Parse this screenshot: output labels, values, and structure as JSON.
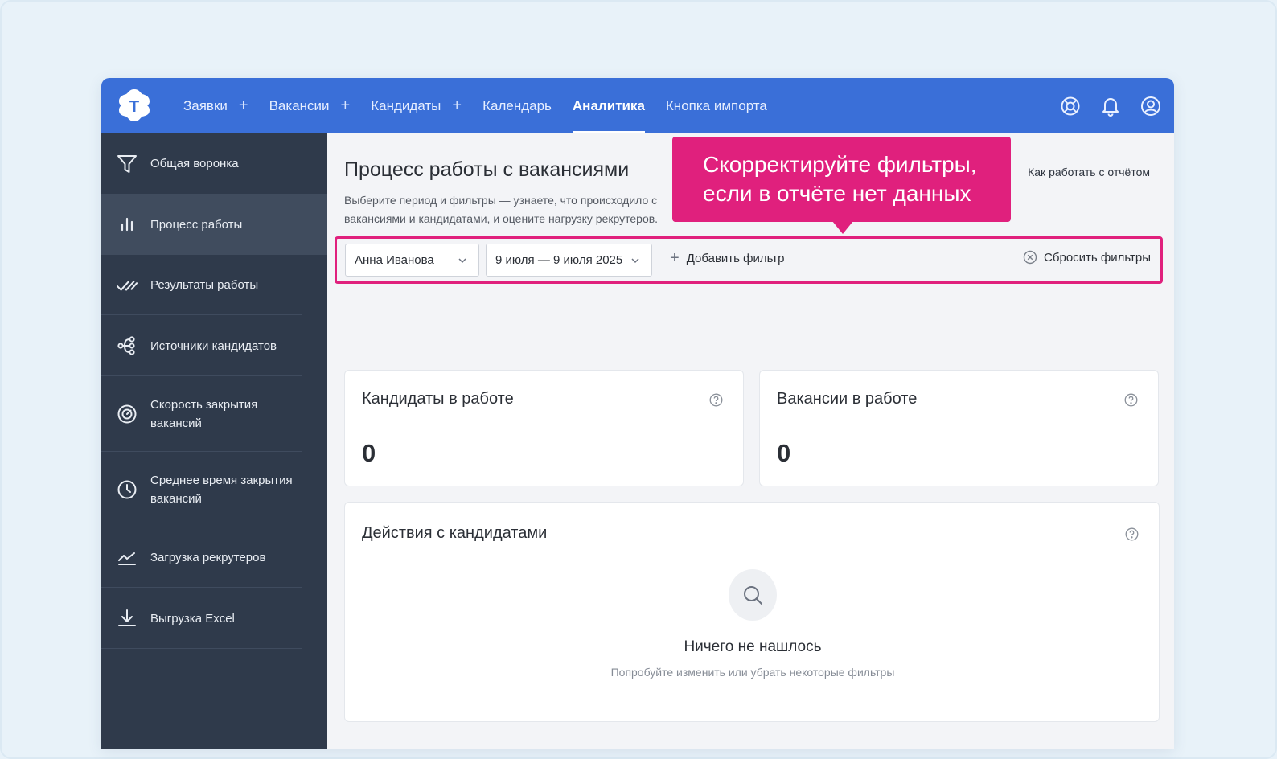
{
  "nav": {
    "items": [
      {
        "label": "Заявки",
        "plus": "+",
        "active": false
      },
      {
        "label": "Вакансии",
        "plus": "+",
        "active": false
      },
      {
        "label": "Кандидаты",
        "plus": "+",
        "active": false
      },
      {
        "label": "Календарь",
        "active": false
      },
      {
        "label": "Аналитика",
        "active": true
      },
      {
        "label": "Кнопка импорта",
        "active": false
      }
    ],
    "logo_letter": "T",
    "icons": [
      "lifebuoy-icon",
      "bell-icon",
      "user-icon"
    ],
    "accent_color": "#3a6fd8"
  },
  "sidebar": {
    "items": [
      {
        "label": "Общая воронка",
        "icon": "funnel-icon"
      },
      {
        "label": "Процесс работы",
        "icon": "bar-chart-icon",
        "active": true
      },
      {
        "label": "Результаты работы",
        "icon": "double-check-icon"
      },
      {
        "label": "Источники кандидатов",
        "icon": "sources-icon"
      },
      {
        "label": "Скорость закрытия вакансий",
        "icon": "speedometer-icon"
      },
      {
        "label": "Среднее время закрытия вакансий",
        "icon": "clock-icon"
      },
      {
        "label": "Загрузка рекрутеров",
        "icon": "trend-icon"
      },
      {
        "label": "Выгрузка Excel",
        "icon": "download-icon"
      }
    ]
  },
  "main": {
    "title": "Процесс работы с вакансиями",
    "description": "Выберите период и фильтры — узнаете, что происходило с вакансиями и кандидатами, и оцените нагрузку рекрутеров. Отчёт обновляется раз в 1 час",
    "help_link": "Как работать с отчётом"
  },
  "filters": {
    "recruiter": "Анна Иванова",
    "period": "9 июля — 9 июля 2025",
    "add_filter": "Добавить фильтр",
    "reset_filters": "Сбросить фильтры"
  },
  "cards": {
    "candidates": {
      "title": "Кандидаты в работе",
      "value": "0"
    },
    "vacancies": {
      "title": "Вакансии в работе",
      "value": "0"
    },
    "actions": {
      "title": "Действия с кандидатами",
      "empty_title": "Ничего не нашлось",
      "empty_subtitle": "Попробуйте изменить или убрать некоторые фильтры"
    }
  },
  "callout": {
    "line1": "Скорректируйте фильтры,",
    "line2": "если в отчёте нет данных",
    "color": "#e0207d"
  }
}
